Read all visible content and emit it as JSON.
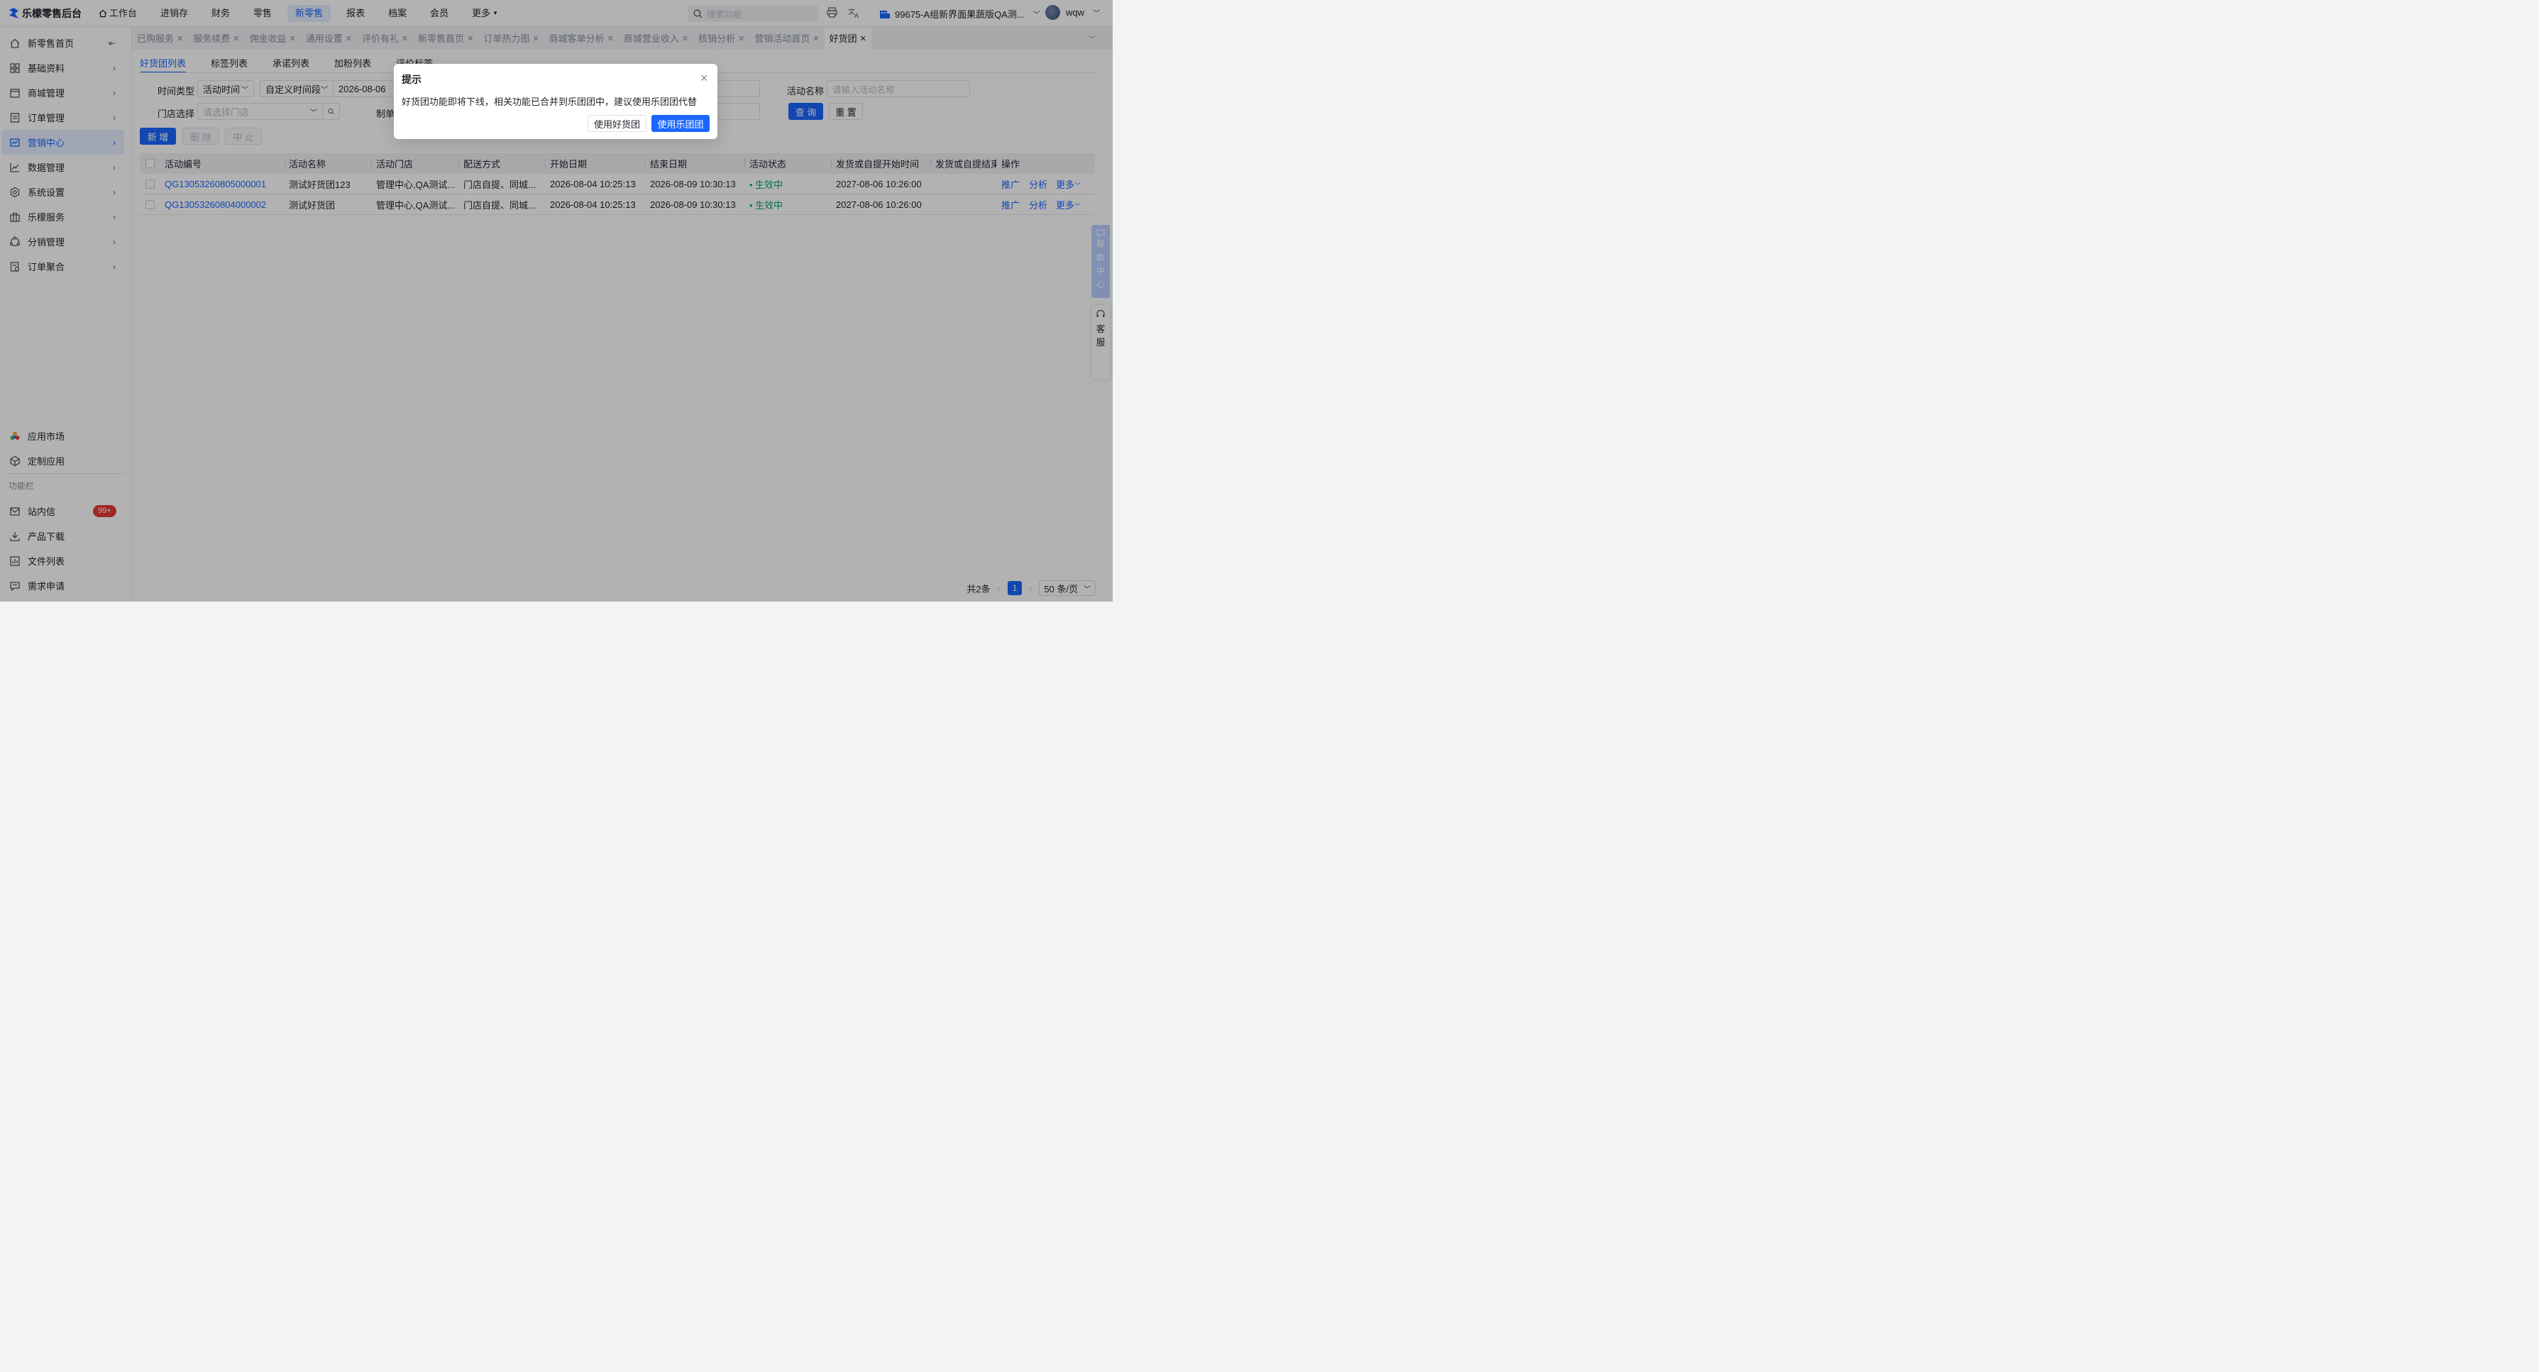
{
  "app": {
    "title": "乐檬零售后台"
  },
  "topnav": [
    {
      "label": "工作台",
      "icon": "home-icon"
    },
    {
      "label": "进销存"
    },
    {
      "label": "财务"
    },
    {
      "label": "零售"
    },
    {
      "label": "新零售",
      "active": true
    },
    {
      "label": "报表"
    },
    {
      "label": "档案"
    },
    {
      "label": "会员"
    },
    {
      "label": "更多"
    }
  ],
  "search": {
    "placeholder": "搜索功能"
  },
  "store": {
    "name": "99675-A组新界面果蔬版QA测..."
  },
  "user": {
    "name": "wqw"
  },
  "sidebar": {
    "items": [
      {
        "label": "新零售首页",
        "icon": "home-icon"
      },
      {
        "label": "基础资料",
        "icon": "grid-icon"
      },
      {
        "label": "商城管理",
        "icon": "shop-icon"
      },
      {
        "label": "订单管理",
        "icon": "order-icon"
      },
      {
        "label": "营销中心",
        "icon": "marketing-icon",
        "active": true
      },
      {
        "label": "数据管理",
        "icon": "chart-icon"
      },
      {
        "label": "系统设置",
        "icon": "settings-icon"
      },
      {
        "label": "乐檬服务",
        "icon": "service-icon"
      },
      {
        "label": "分销管理",
        "icon": "distribution-icon"
      },
      {
        "label": "订单聚合",
        "icon": "aggregate-icon"
      }
    ],
    "bottom_items": [
      {
        "label": "应用市场",
        "icon": "app-market-icon"
      },
      {
        "label": "定制应用",
        "icon": "custom-app-icon"
      }
    ],
    "section_label": "功能栏",
    "tool_items": [
      {
        "label": "站内信",
        "icon": "mail-icon",
        "badge": "99+"
      },
      {
        "label": "产品下载",
        "icon": "download-icon"
      },
      {
        "label": "文件列表",
        "icon": "file-icon"
      },
      {
        "label": "需求申请",
        "icon": "request-icon"
      }
    ]
  },
  "tabs": [
    {
      "label": "已购服务"
    },
    {
      "label": "服务续费"
    },
    {
      "label": "佣金收益"
    },
    {
      "label": "通用设置"
    },
    {
      "label": "评价有礼"
    },
    {
      "label": "新零售首页"
    },
    {
      "label": "订单热力图"
    },
    {
      "label": "商城客单分析"
    },
    {
      "label": "商城营业收入"
    },
    {
      "label": "核销分析"
    },
    {
      "label": "营销活动首页"
    },
    {
      "label": "好货团",
      "active": true
    }
  ],
  "subtabs": [
    {
      "label": "好货团列表",
      "active": true
    },
    {
      "label": "标签列表"
    },
    {
      "label": "承诺列表"
    },
    {
      "label": "加粉列表"
    },
    {
      "label": "评价标签"
    }
  ],
  "filters": {
    "time_type_label": "时间类型",
    "time_type_value": "活动时间",
    "range_value": "自定义时间段",
    "date_value": "2026-08-06",
    "store_label": "门店选择",
    "store_placeholder": "请选择门店",
    "maker_label": "制单",
    "activity_name_label": "活动名称",
    "activity_name_placeholder": "请输入活动名称",
    "query_label": "查 询",
    "reset_label": "重 置"
  },
  "actions": {
    "add": "新 增",
    "delete": "删 除",
    "stop": "中 止"
  },
  "table": {
    "columns": [
      "活动编号",
      "活动名称",
      "活动门店",
      "配送方式",
      "开始日期",
      "结束日期",
      "活动状态",
      "发货或自提开始时间",
      "发货或自提结束",
      "操作"
    ],
    "rows": [
      {
        "id": "QG13053260805000001",
        "name": "测试好货团123",
        "store": "管理中心,QA测试...",
        "delivery": "门店自提、同城...",
        "start": "2026-08-04 10:25:13",
        "end": "2026-08-09 10:30:13",
        "status": "生效中",
        "ship_start": "2027-08-06 10:26:00",
        "ship_end": "",
        "ops": [
          "推广",
          "分析",
          "更多"
        ]
      },
      {
        "id": "QG13053260804000002",
        "name": "测试好货团",
        "store": "管理中心,QA测试...",
        "delivery": "门店自提、同城...",
        "start": "2026-08-04 10:25:13",
        "end": "2026-08-09 10:30:13",
        "status": "生效中",
        "ship_start": "2027-08-06 10:26:00",
        "ship_end": "",
        "ops": [
          "推广",
          "分析",
          "更多"
        ]
      }
    ]
  },
  "pagination": {
    "total": "共2条",
    "page": "1",
    "page_size": "50 条/页"
  },
  "float": {
    "help": [
      "帮",
      "助",
      "中",
      "心"
    ],
    "service": [
      "客",
      "服"
    ]
  },
  "modal": {
    "title": "提示",
    "body": "好货团功能即将下线，相关功能已合并到乐团团中，建议使用乐团团代替",
    "cancel": "使用好货团",
    "confirm": "使用乐团团"
  },
  "colors": {
    "primary": "#1a66ff",
    "success": "#00a870",
    "badge": "#e53935"
  }
}
